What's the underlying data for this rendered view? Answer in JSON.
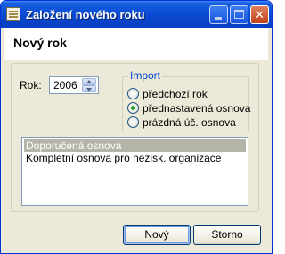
{
  "window": {
    "title": "Založení nového roku",
    "icon": "document-icon",
    "controls": {
      "minimize_icon": "minimize-icon",
      "maximize_icon": "maximize-icon",
      "close_icon": "close-icon",
      "close_glyph": "✕"
    }
  },
  "header": {
    "title": "Nový rok"
  },
  "year": {
    "label": "Rok:",
    "value": "2006"
  },
  "import": {
    "legend": "Import",
    "options": [
      {
        "label": "předchozí rok",
        "checked": false
      },
      {
        "label": "přednastavená osnova",
        "checked": true
      },
      {
        "label": "prázdná úč. osnova",
        "checked": false
      }
    ]
  },
  "list": {
    "items": [
      {
        "label": "Doporučená osnova",
        "selected": true
      },
      {
        "label": "Kompletní osnova pro nezisk. organizace",
        "selected": false
      }
    ]
  },
  "buttons": {
    "ok": "Nový",
    "cancel": "Storno"
  },
  "colors": {
    "title_bar": "#0a4dd6",
    "accent_legend": "#0046d5",
    "radio_dot": "#21a121"
  }
}
